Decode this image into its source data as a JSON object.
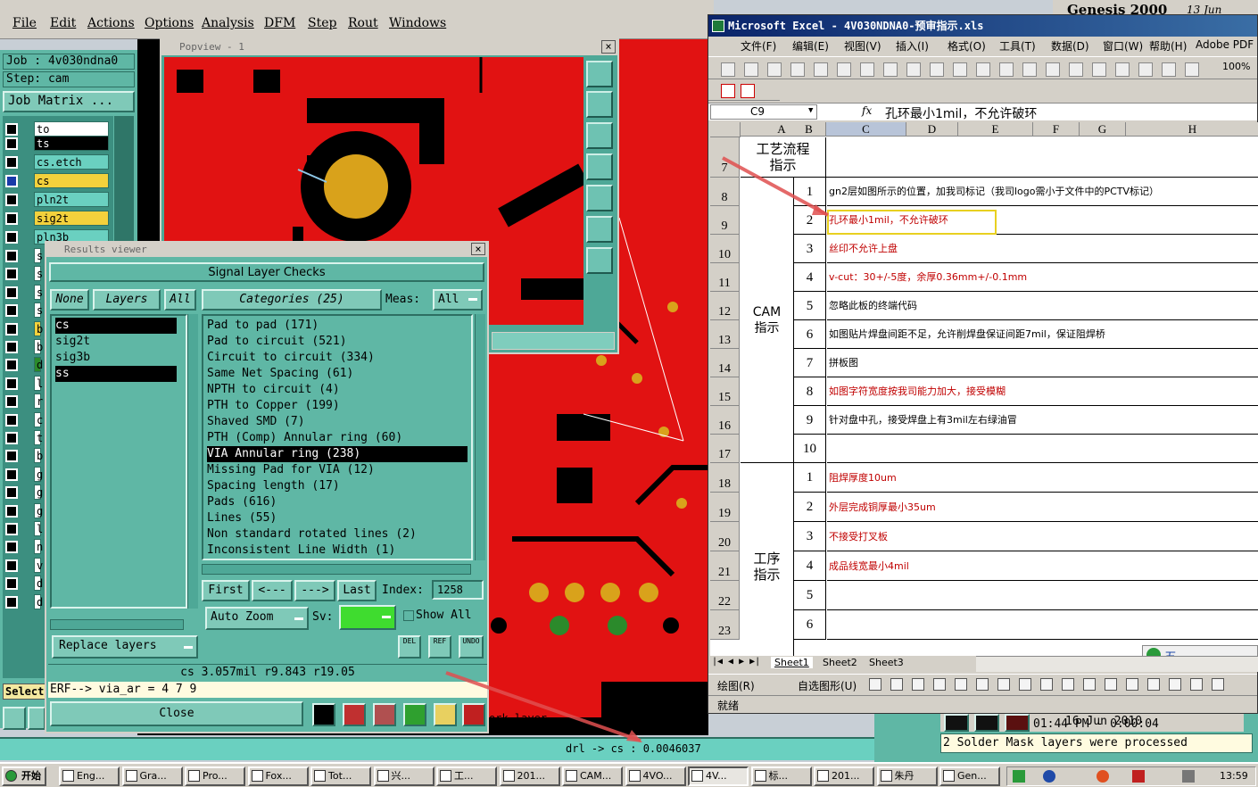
{
  "genesis": {
    "menu": [
      "File",
      "Edit",
      "Actions",
      "Options",
      "Analysis",
      "DFM",
      "Step",
      "Rout",
      "Windows"
    ],
    "title_fragment": "Genesis 2000",
    "date_fragment": "13 Jun",
    "job_label": "Job : 4v030ndna0",
    "step_label": "Step: cam",
    "job_matrix_button": "Job Matrix ...",
    "layers": [
      {
        "name": "to",
        "style": "white"
      },
      {
        "name": "ts",
        "style": "teal"
      },
      {
        "name": "cs.etch",
        "style": "teal"
      },
      {
        "name": "cs",
        "style": "yellow"
      },
      {
        "name": "pln2t",
        "style": "teal"
      },
      {
        "name": "sig2t",
        "style": "yellow"
      },
      {
        "name": "pln3b",
        "style": "teal"
      }
    ],
    "layer_stubs": [
      "s",
      "s",
      "s",
      "s",
      "b",
      "b",
      "d",
      "l",
      "r",
      "c",
      "t",
      "b",
      "g",
      "g",
      "g",
      "l",
      "n",
      "v",
      "d",
      "d"
    ],
    "select_label": "Select",
    "status_line": "drl -> cs : 0.0046037",
    "work_layer_fragment": "ork layer",
    "clock_time": "01:44 PM - 0:00:04",
    "clock_date_fragment": "16 Jun 2010",
    "message": "2 Solder Mask layers were processed"
  },
  "popview": {
    "title": "Popview - 1",
    "close": "×"
  },
  "results": {
    "title": "Results viewer",
    "close": "×",
    "panel_title": "Signal Layer Checks",
    "none_btn": "None",
    "layers_btn": "Layers",
    "all_btn": "All",
    "categories_label": "Categories (25)",
    "meas_label": "Meas:",
    "meas_value": "All",
    "layer_list": [
      {
        "name": "cs",
        "selected": true
      },
      {
        "name": "sig2t",
        "selected": false
      },
      {
        "name": "sig3b",
        "selected": false
      },
      {
        "name": "ss",
        "selected": true
      }
    ],
    "categories": [
      {
        "name": "Pad to pad (171)",
        "selected": false
      },
      {
        "name": "Pad to circuit (521)",
        "selected": false
      },
      {
        "name": "Circuit to circuit (334)",
        "selected": false
      },
      {
        "name": "Same Net Spacing (61)",
        "selected": false
      },
      {
        "name": "NPTH to circuit (4)",
        "selected": false
      },
      {
        "name": "PTH to Copper (199)",
        "selected": false
      },
      {
        "name": "Shaved SMD (7)",
        "selected": false
      },
      {
        "name": "PTH (Comp) Annular ring (60)",
        "selected": false
      },
      {
        "name": "VIA Annular ring (238)",
        "selected": true
      },
      {
        "name": "Missing Pad for VIA (12)",
        "selected": false
      },
      {
        "name": "Spacing length (17)",
        "selected": false
      },
      {
        "name": "Pads (616)",
        "selected": false
      },
      {
        "name": "Lines (55)",
        "selected": false
      },
      {
        "name": "Non standard rotated lines (2)",
        "selected": false
      },
      {
        "name": "Inconsistent Line Width (1)",
        "selected": false
      }
    ],
    "nav": {
      "first": "First",
      "prev": "<---",
      "next": "--->",
      "last": "Last",
      "index_label": "Index:",
      "index_value": "1258"
    },
    "auto_zoom": "Auto Zoom",
    "sv_label": "Sv:",
    "show_all": "Show All",
    "replace_layers": "Replace layers",
    "del": "DEL",
    "ref": "REF",
    "undo": "UNDO",
    "measure_line": "cs 3.057mil   r9.843  r19.05",
    "erf_line": "ERF--> via_ar = 4 7 9",
    "close_btn": "Close"
  },
  "excel": {
    "title": "Microsoft Excel - 4V030NDNA0-预审指示.xls",
    "menu": [
      "文件(F)",
      "编辑(E)",
      "视图(V)",
      "插入(I)",
      "格式(O)",
      "工具(T)",
      "数据(D)",
      "窗口(W)",
      "帮助(H)",
      "Adobe PDF"
    ],
    "zoom": "100%",
    "cell_ref": "C9",
    "fx": "fx",
    "formula": "孔环最小1mil，不允许破环",
    "columns": [
      "A",
      "B",
      "C",
      "D",
      "E",
      "F",
      "G",
      "H"
    ],
    "section_headers": {
      "process_flow": "工艺流程\n指示",
      "cam": "CAM\n指示",
      "procedure": "工序\n指示"
    },
    "cam_rows": [
      {
        "row": "8",
        "num": "1",
        "text": "gn2层如图所示的位置，加我司标记（我司logo需小于文件中的PCTV标记）",
        "color": "blk"
      },
      {
        "row": "9",
        "num": "2",
        "text": "孔环最小1mil，不允许破环",
        "color": "red"
      },
      {
        "row": "10",
        "num": "3",
        "text": "丝印不允许上盘",
        "color": "red"
      },
      {
        "row": "11",
        "num": "4",
        "text": "v-cut：30+/-5度，余厚0.36mm+/-0.1mm",
        "color": "red"
      },
      {
        "row": "12",
        "num": "5",
        "text": "忽略此板的终端代码",
        "color": "blk"
      },
      {
        "row": "13",
        "num": "6",
        "text": "如图贴片焊盘间距不足，允许削焊盘保证间距7mil，保证阻焊桥",
        "color": "blk"
      },
      {
        "row": "14",
        "num": "7",
        "text": "拼板图",
        "color": "blk"
      },
      {
        "row": "15",
        "num": "8",
        "text": "如图字符宽度按我司能力加大，接受模糊",
        "color": "red"
      },
      {
        "row": "16",
        "num": "9",
        "text": "针对盘中孔，接受焊盘上有3mil左右绿油冒",
        "color": "blk"
      },
      {
        "row": "17",
        "num": "10",
        "text": "",
        "color": "blk"
      }
    ],
    "proc_rows": [
      {
        "row": "18",
        "num": "1",
        "text": "阻焊厚度10um",
        "color": "red"
      },
      {
        "row": "19",
        "num": "2",
        "text": "外层完成铜厚最小35um",
        "color": "red"
      },
      {
        "row": "20",
        "num": "3",
        "text": "不接受打叉板",
        "color": "red"
      },
      {
        "row": "21",
        "num": "4",
        "text": "成品线宽最小4mil",
        "color": "red"
      },
      {
        "row": "22",
        "num": "5",
        "text": "",
        "color": "blk"
      },
      {
        "row": "23",
        "num": "6",
        "text": "",
        "color": "blk"
      }
    ],
    "row7": "7",
    "sheets": [
      "Sheet1",
      "Sheet2",
      "Sheet3"
    ],
    "draw_label": "绘图(R)",
    "autoshape_label": "自选图形(U)",
    "status": "就绪",
    "ime": "五"
  },
  "taskbar": {
    "start": "开始",
    "tasks": [
      "Eng...",
      "Gra...",
      "Pro...",
      "Fox...",
      "Tot...",
      "兴...",
      "工...",
      "201...",
      "CAM...",
      "4VO...",
      "4V...",
      "标...",
      "201...",
      "朱丹",
      "Gen..."
    ],
    "active_index": 10,
    "clock": "13:59"
  }
}
